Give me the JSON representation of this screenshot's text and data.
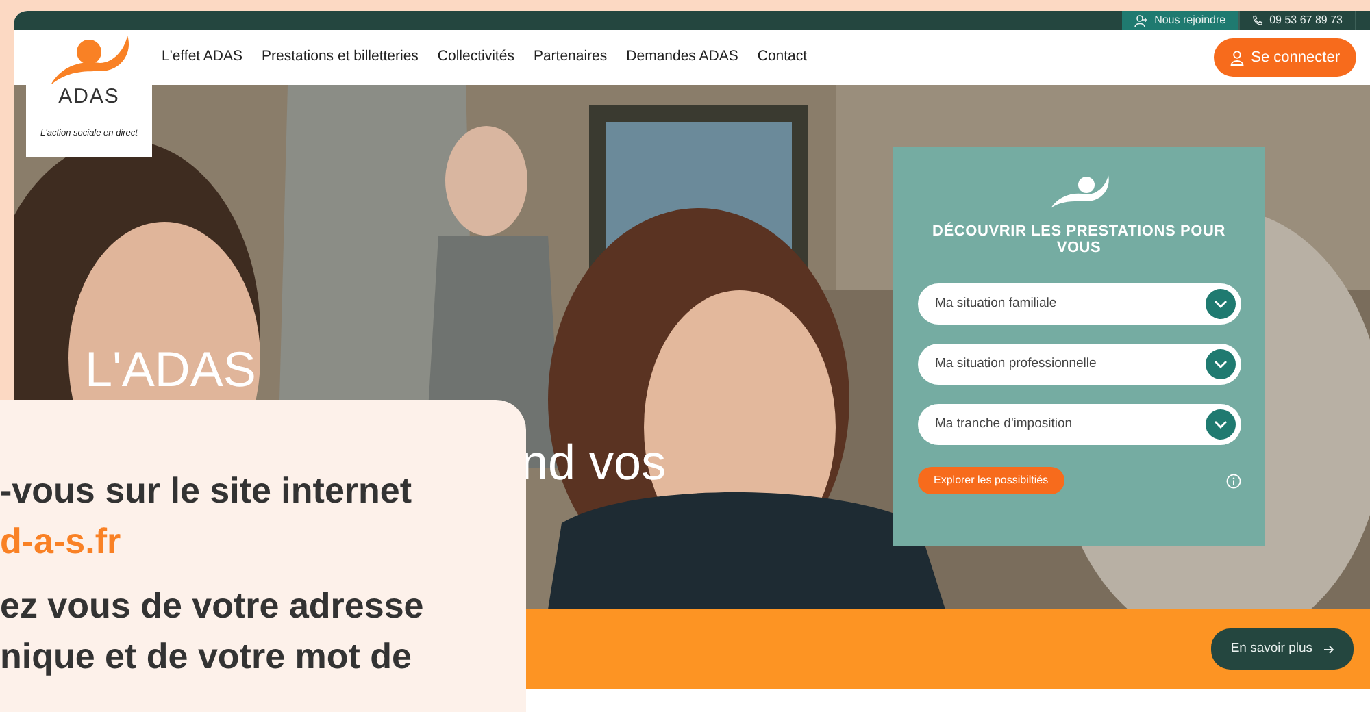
{
  "top_bar": {
    "links": [
      {
        "label": "Nous rejoindre",
        "kind": "join"
      },
      {
        "label": "09 53 67 89 73",
        "kind": "phone"
      }
    ]
  },
  "logo": {
    "name": "ADAS",
    "tagline": "L'action sociale en direct"
  },
  "nav": {
    "items": [
      "L'effet ADAS",
      "Prestations et billetteries",
      "Collectivités",
      "Partenaires",
      "Demandes ADAS",
      "Contact"
    ],
    "login_button": "Se connecter"
  },
  "hero": {
    "title_lines": [
      "L'ADAS",
      "nd vos"
    ]
  },
  "finder": {
    "title": "DÉCOUVRIR LES PRESTATIONS POUR VOUS",
    "selects": [
      {
        "placeholder": "Ma situation familiale"
      },
      {
        "placeholder": "Ma situation professionnelle"
      },
      {
        "placeholder": "Ma tranche d'imposition"
      }
    ],
    "button": "Explorer les possibiltiés"
  },
  "banner": {
    "button": "En savoir plus"
  },
  "popup": {
    "lines": [
      {
        "text": "-vous sur le site internet",
        "kind": "text"
      },
      {
        "text": "d-a-s.fr",
        "kind": "link"
      },
      {
        "text": "ez vous de votre adresse",
        "kind": "text"
      },
      {
        "text": "nique et de votre mot de",
        "kind": "text"
      }
    ]
  }
}
